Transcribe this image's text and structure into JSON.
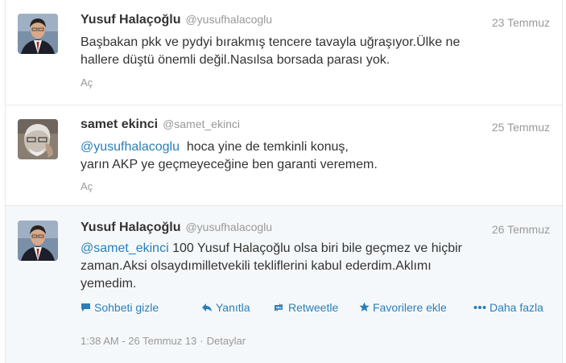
{
  "tweets": [
    {
      "name": "Yusuf Halaçoğlu",
      "handle": "@yusufhalacoglu",
      "date": "23 Temmuz",
      "text_lines": [
        "Başbakan pkk ve pydyi bırakmış tencere tavayla uğraşıyor.Ülke ne",
        "hallere düştü önemli değil.Nasılsa borsada parası yok."
      ],
      "expand_label": "Aç"
    },
    {
      "name": "samet ekinci",
      "handle": "@samet_ekinci",
      "date": "25 Temmuz",
      "mention": "@yusufhalacoglu",
      "text_line1_rest": "  hoca yine de temkinli konuş,",
      "text_line2": "yarın AKP ye geçmeyeceğine ben garanti veremem.",
      "expand_label": "Aç"
    },
    {
      "name": "Yusuf Halaçoğlu",
      "handle": "@yusufhalacoglu",
      "date": "26 Temmuz",
      "mention": "@samet_ekinci",
      "text_line1_rest": " 100 Yusuf Halaçoğlu olsa biri bile geçmez ve hiçbir",
      "text_line2": "zaman.Aksi olsaydımilletvekili tekliflerini kabul ederdim.Aklımı",
      "text_line3": "yemedim.",
      "actions": {
        "hide_conversation": "Sohbeti gizle",
        "reply": "Yanıtla",
        "retweet": "Retweetle",
        "favorite": "Favorilere ekle",
        "more": "Daha fazla"
      },
      "timestamp": "1:38 AM - 26 Temmuz 13",
      "separator": "·",
      "details": "Detaylar"
    }
  ],
  "icons": {
    "conversation": "speech-bubble-icon",
    "reply": "reply-arrow-icon",
    "retweet": "retweet-icon",
    "favorite": "star-icon",
    "more": "ellipsis-icon"
  },
  "colors": {
    "link": "#2a7fb8",
    "muted": "#999999",
    "text": "#333333",
    "expanded_bg": "#f5f8fa"
  }
}
